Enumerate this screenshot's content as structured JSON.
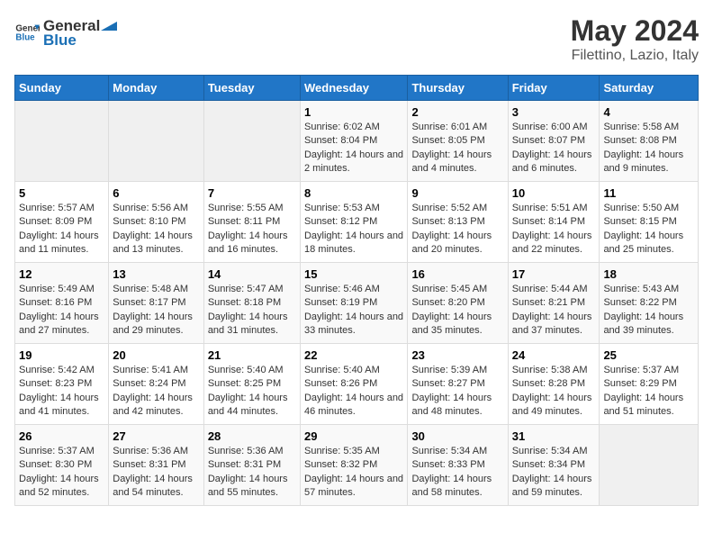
{
  "header": {
    "logo": {
      "general": "General",
      "blue": "Blue"
    },
    "title": "May 2024",
    "subtitle": "Filettino, Lazio, Italy"
  },
  "days_of_week": [
    "Sunday",
    "Monday",
    "Tuesday",
    "Wednesday",
    "Thursday",
    "Friday",
    "Saturday"
  ],
  "weeks": [
    [
      {
        "day": "",
        "info": ""
      },
      {
        "day": "",
        "info": ""
      },
      {
        "day": "",
        "info": ""
      },
      {
        "day": "1",
        "sunrise": "6:02 AM",
        "sunset": "8:04 PM",
        "daylight": "14 hours and 2 minutes."
      },
      {
        "day": "2",
        "sunrise": "6:01 AM",
        "sunset": "8:05 PM",
        "daylight": "14 hours and 4 minutes."
      },
      {
        "day": "3",
        "sunrise": "6:00 AM",
        "sunset": "8:07 PM",
        "daylight": "14 hours and 6 minutes."
      },
      {
        "day": "4",
        "sunrise": "5:58 AM",
        "sunset": "8:08 PM",
        "daylight": "14 hours and 9 minutes."
      }
    ],
    [
      {
        "day": "5",
        "sunrise": "5:57 AM",
        "sunset": "8:09 PM",
        "daylight": "14 hours and 11 minutes."
      },
      {
        "day": "6",
        "sunrise": "5:56 AM",
        "sunset": "8:10 PM",
        "daylight": "14 hours and 13 minutes."
      },
      {
        "day": "7",
        "sunrise": "5:55 AM",
        "sunset": "8:11 PM",
        "daylight": "14 hours and 16 minutes."
      },
      {
        "day": "8",
        "sunrise": "5:53 AM",
        "sunset": "8:12 PM",
        "daylight": "14 hours and 18 minutes."
      },
      {
        "day": "9",
        "sunrise": "5:52 AM",
        "sunset": "8:13 PM",
        "daylight": "14 hours and 20 minutes."
      },
      {
        "day": "10",
        "sunrise": "5:51 AM",
        "sunset": "8:14 PM",
        "daylight": "14 hours and 22 minutes."
      },
      {
        "day": "11",
        "sunrise": "5:50 AM",
        "sunset": "8:15 PM",
        "daylight": "14 hours and 25 minutes."
      }
    ],
    [
      {
        "day": "12",
        "sunrise": "5:49 AM",
        "sunset": "8:16 PM",
        "daylight": "14 hours and 27 minutes."
      },
      {
        "day": "13",
        "sunrise": "5:48 AM",
        "sunset": "8:17 PM",
        "daylight": "14 hours and 29 minutes."
      },
      {
        "day": "14",
        "sunrise": "5:47 AM",
        "sunset": "8:18 PM",
        "daylight": "14 hours and 31 minutes."
      },
      {
        "day": "15",
        "sunrise": "5:46 AM",
        "sunset": "8:19 PM",
        "daylight": "14 hours and 33 minutes."
      },
      {
        "day": "16",
        "sunrise": "5:45 AM",
        "sunset": "8:20 PM",
        "daylight": "14 hours and 35 minutes."
      },
      {
        "day": "17",
        "sunrise": "5:44 AM",
        "sunset": "8:21 PM",
        "daylight": "14 hours and 37 minutes."
      },
      {
        "day": "18",
        "sunrise": "5:43 AM",
        "sunset": "8:22 PM",
        "daylight": "14 hours and 39 minutes."
      }
    ],
    [
      {
        "day": "19",
        "sunrise": "5:42 AM",
        "sunset": "8:23 PM",
        "daylight": "14 hours and 41 minutes."
      },
      {
        "day": "20",
        "sunrise": "5:41 AM",
        "sunset": "8:24 PM",
        "daylight": "14 hours and 42 minutes."
      },
      {
        "day": "21",
        "sunrise": "5:40 AM",
        "sunset": "8:25 PM",
        "daylight": "14 hours and 44 minutes."
      },
      {
        "day": "22",
        "sunrise": "5:40 AM",
        "sunset": "8:26 PM",
        "daylight": "14 hours and 46 minutes."
      },
      {
        "day": "23",
        "sunrise": "5:39 AM",
        "sunset": "8:27 PM",
        "daylight": "14 hours and 48 minutes."
      },
      {
        "day": "24",
        "sunrise": "5:38 AM",
        "sunset": "8:28 PM",
        "daylight": "14 hours and 49 minutes."
      },
      {
        "day": "25",
        "sunrise": "5:37 AM",
        "sunset": "8:29 PM",
        "daylight": "14 hours and 51 minutes."
      }
    ],
    [
      {
        "day": "26",
        "sunrise": "5:37 AM",
        "sunset": "8:30 PM",
        "daylight": "14 hours and 52 minutes."
      },
      {
        "day": "27",
        "sunrise": "5:36 AM",
        "sunset": "8:31 PM",
        "daylight": "14 hours and 54 minutes."
      },
      {
        "day": "28",
        "sunrise": "5:36 AM",
        "sunset": "8:31 PM",
        "daylight": "14 hours and 55 minutes."
      },
      {
        "day": "29",
        "sunrise": "5:35 AM",
        "sunset": "8:32 PM",
        "daylight": "14 hours and 57 minutes."
      },
      {
        "day": "30",
        "sunrise": "5:34 AM",
        "sunset": "8:33 PM",
        "daylight": "14 hours and 58 minutes."
      },
      {
        "day": "31",
        "sunrise": "5:34 AM",
        "sunset": "8:34 PM",
        "daylight": "14 hours and 59 minutes."
      },
      {
        "day": "",
        "info": ""
      }
    ]
  ],
  "labels": {
    "sunrise_prefix": "Sunrise: ",
    "sunset_prefix": "Sunset: ",
    "daylight_prefix": "Daylight: "
  }
}
